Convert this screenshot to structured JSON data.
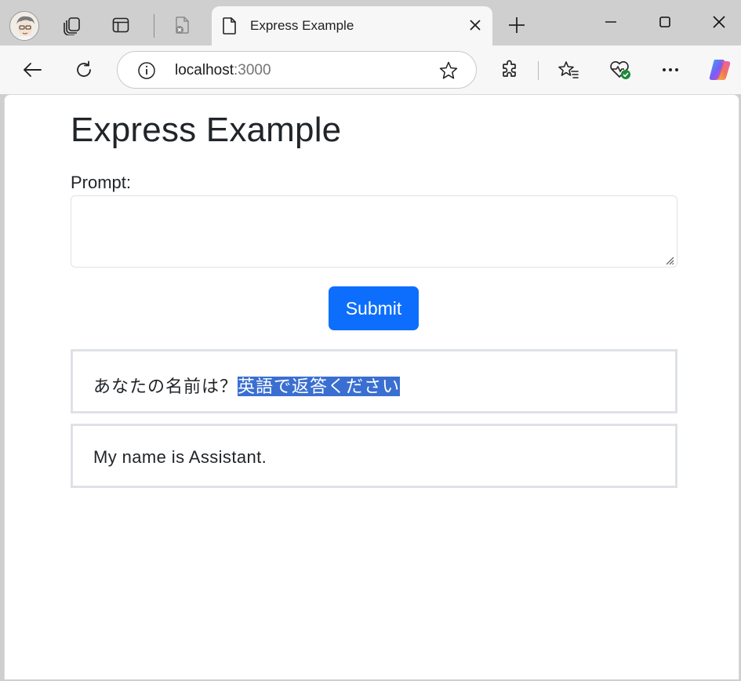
{
  "browser": {
    "active_tab_title": "Express Example",
    "url_host": "localhost",
    "url_port": ":3000"
  },
  "page": {
    "heading": "Express Example",
    "prompt_label": "Prompt:",
    "prompt_value": "",
    "submit_label": "Submit",
    "question_text": "あなたの名前は？",
    "question_selected_text": "英語で返答ください",
    "answer_text": "My name is Assistant."
  },
  "colors": {
    "primary_button": "#0d6efd",
    "selection": "#3a6fd1",
    "copilot": "#7b5cf5"
  }
}
